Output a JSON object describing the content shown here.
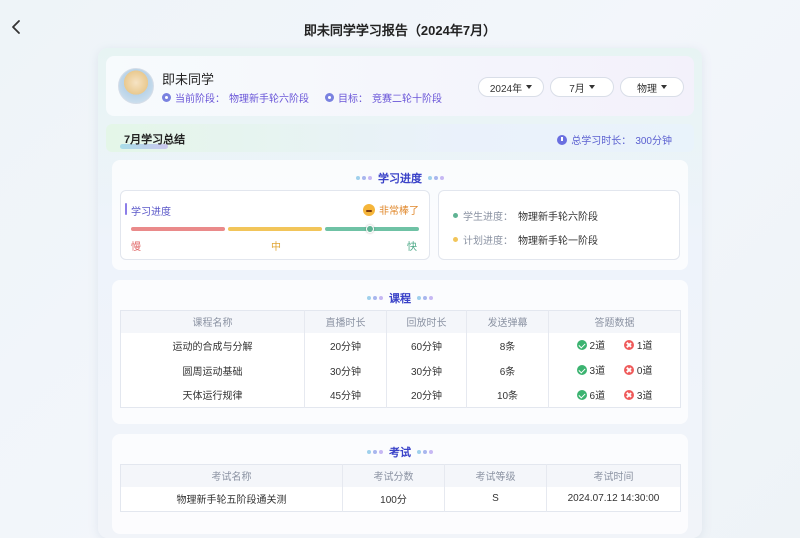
{
  "header": {
    "title": "即未同学学习报告（2024年7月）"
  },
  "profile": {
    "name": "即未同学",
    "stage_label": "当前阶段：",
    "stage_value": "物理新手轮六阶段",
    "goal_label": "目标：",
    "goal_value": "竞赛二轮十阶段"
  },
  "filters": {
    "year": "2024年",
    "month": "7月",
    "subject": "物理"
  },
  "summary": {
    "title": "7月学习总结",
    "total_time_label": "总学习时长：",
    "total_time_value": "300分钟"
  },
  "progress": {
    "section_title": "学习进度",
    "card_label": "学习进度",
    "badge": "非常棒了",
    "speed_labels": {
      "slow": "慢",
      "mid": "中",
      "fast": "快"
    },
    "speed_level": 0.83,
    "student_label": "学生进度：",
    "student_value": "物理新手轮六阶段",
    "plan_label": "计划进度：",
    "plan_value": "物理新手轮一阶段",
    "colors": {
      "slow": "#ea8a8a",
      "mid": "#f2c55a",
      "fast": "#6fc2a5"
    }
  },
  "courses": {
    "section_title": "课程",
    "columns": [
      "课程名称",
      "直播时长",
      "回放时长",
      "发送弹幕",
      "答题数据"
    ],
    "rows": [
      {
        "name": "运动的合成与分解",
        "live": "20分钟",
        "replay": "60分钟",
        "danmaku": "8条",
        "correct": "2道",
        "wrong": "1道"
      },
      {
        "name": "圆周运动基础",
        "live": "30分钟",
        "replay": "30分钟",
        "danmaku": "6条",
        "correct": "3道",
        "wrong": "0道"
      },
      {
        "name": "天体运行规律",
        "live": "45分钟",
        "replay": "20分钟",
        "danmaku": "10条",
        "correct": "6道",
        "wrong": "3道"
      }
    ]
  },
  "exams": {
    "section_title": "考试",
    "columns": [
      "考试名称",
      "考试分数",
      "考试等级",
      "考试时间"
    ],
    "rows": [
      {
        "name": "物理新手轮五阶段通关测",
        "score": "100分",
        "grade": "S",
        "time": "2024.07.12 14:30:00"
      }
    ]
  }
}
